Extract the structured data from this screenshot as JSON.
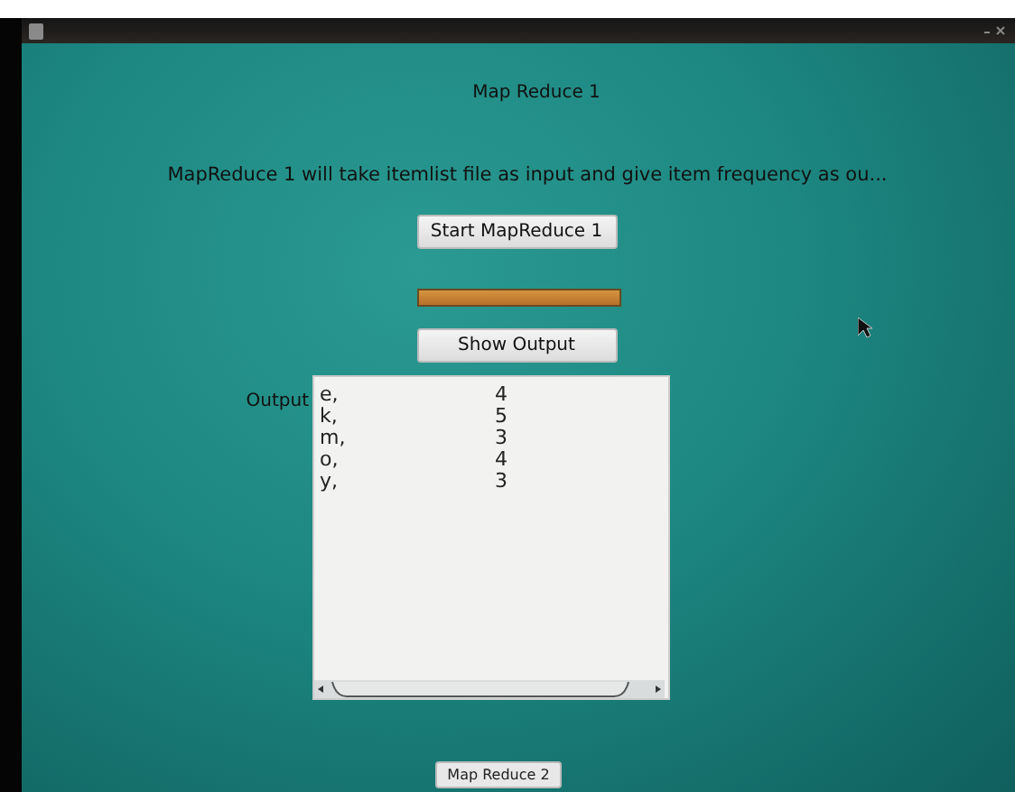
{
  "window": {
    "title": "Map Reduce 1"
  },
  "description": "MapReduce 1 will take itemlist file as input and give item frequency as ou...",
  "start_button": "Start MapReduce 1",
  "progress": {
    "level": 1
  },
  "show_output_button": "Show Output",
  "output": {
    "label": "Output",
    "rows": [
      {
        "item": "e,",
        "count": "4"
      },
      {
        "item": "k,",
        "count": "5"
      },
      {
        "item": "m,",
        "count": "3"
      },
      {
        "item": "o,",
        "count": "4"
      },
      {
        "item": "y,",
        "count": "3"
      }
    ]
  },
  "next_button": "Map Reduce 2"
}
